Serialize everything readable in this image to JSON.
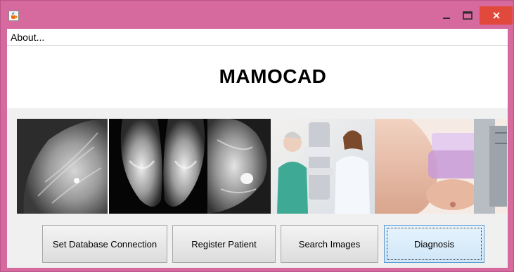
{
  "window": {
    "icon": "java-cup-icon",
    "controls": [
      "minimize-icon",
      "maximize-icon",
      "close-icon"
    ],
    "colors": {
      "frame": "#d66a9e",
      "close": "#e2493d"
    }
  },
  "menu": {
    "about_label": "About..."
  },
  "header": {
    "title": "MAMOCAD"
  },
  "banner": {
    "image": "mammography-collage-image"
  },
  "buttons": {
    "db": "Set Database Connection",
    "register": "Register Patient",
    "search": "Search Images",
    "diagnosis": "Diagnosis"
  }
}
